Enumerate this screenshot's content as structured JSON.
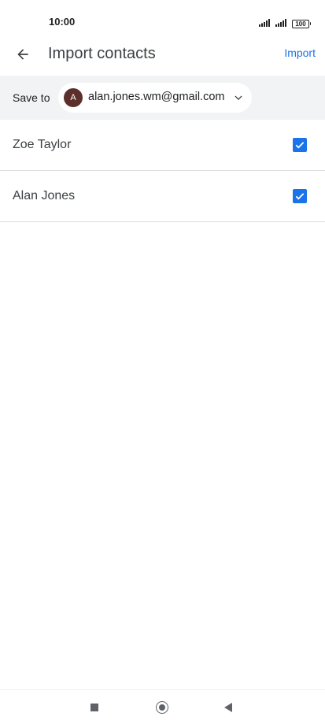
{
  "status_bar": {
    "time": "10:00",
    "battery": "100",
    "icons": [
      "signal-icon",
      "signal-icon",
      "battery-icon"
    ]
  },
  "app_bar": {
    "title": "Import contacts",
    "import_label": "Import",
    "back_icon": "arrow-left-icon"
  },
  "save_to": {
    "label": "Save to",
    "avatar_letter": "A",
    "account_email": "alan.jones.wm@gmail.com",
    "avatar_color": "#5d2f2a"
  },
  "contacts": [
    {
      "name": "Zoe Taylor",
      "checked": true
    },
    {
      "name": "Alan Jones",
      "checked": true
    }
  ],
  "colors": {
    "accent": "#1a73e8",
    "bar_background": "#f1f3f4"
  },
  "nav_bar": {
    "icons": [
      "recents-icon",
      "home-icon",
      "back-icon"
    ]
  }
}
